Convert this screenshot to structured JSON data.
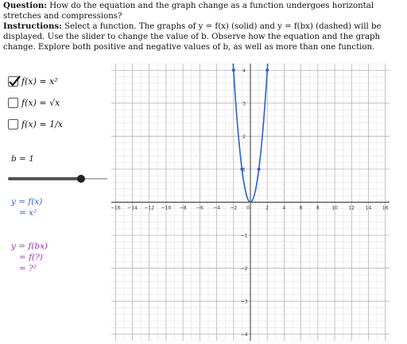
{
  "instructions": {
    "question_label": "Question:",
    "question_text": " How do the equation and the graph change as a function undergoes horizontal stretches and compressions?",
    "instructions_label": "Instructions:",
    "instructions_text": " Select a function. The graphs of y = f(x) (solid) and y = f(bx) (dashed) will be displayed. Use the slider to change the value of b. Observe how the equation and the graph change. Explore both positive and negative values of b, as well as more than one function."
  },
  "functions": [
    {
      "label": "f(x) = x²",
      "checked": true
    },
    {
      "label": "f(x) = √x",
      "checked": false
    },
    {
      "label": "f(x) = 1/x",
      "checked": false
    }
  ],
  "slider": {
    "label": "b = 1",
    "value": 1,
    "min": -2,
    "max": 2
  },
  "equation_solid": {
    "line1": "y = f(x)",
    "line2": "= x²"
  },
  "equation_dashed": {
    "line1": "y = f(bx)",
    "line2": "= f(?)",
    "line3": "= ?²"
  },
  "colors": {
    "solid_curve": "#2b60c8",
    "dashed_eq": "#9b2fae",
    "grid_minor": "#dddddd",
    "grid_major": "#aaaaaa",
    "axis": "#333333"
  },
  "graph": {
    "x_range": [
      -16.5,
      16.5
    ],
    "y_range": [
      -4.2,
      4.2
    ],
    "x_tick_labels": [
      "−16",
      "−14",
      "−12",
      "−10",
      "−8",
      "−6",
      "−4",
      "−2",
      "0",
      "2",
      "4",
      "6",
      "8",
      "10",
      "12",
      "14",
      "16"
    ],
    "y_tick_labels": [
      "4",
      "3",
      "2",
      "1",
      "−1",
      "−2",
      "−3",
      "−4"
    ],
    "curve": "y = x²",
    "points": [
      {
        "x": -1,
        "y": 1
      },
      {
        "x": 1,
        "y": 1
      },
      {
        "x": -2,
        "y": 4
      },
      {
        "x": 2,
        "y": 4
      }
    ]
  }
}
